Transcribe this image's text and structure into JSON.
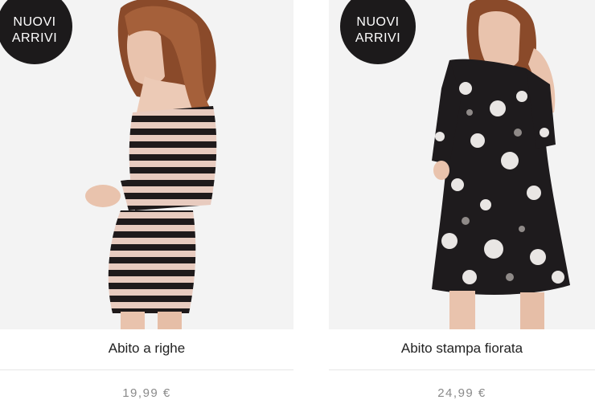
{
  "products": [
    {
      "badge_line1": "NUOVI",
      "badge_line2": "ARRIVI",
      "name": "Abito a righe",
      "price": "19,99 €",
      "image": "striped-dress-model-photo"
    },
    {
      "badge_line1": "NUOVI",
      "badge_line2": "ARRIVI",
      "name": "Abito stampa fiorata",
      "price": "24,99 €",
      "image": "floral-dress-model-photo"
    }
  ],
  "colors": {
    "badge_bg": "#1c1a1b",
    "badge_text": "#ffffff",
    "title_text": "#222222",
    "price_text": "#8a8a8a"
  }
}
